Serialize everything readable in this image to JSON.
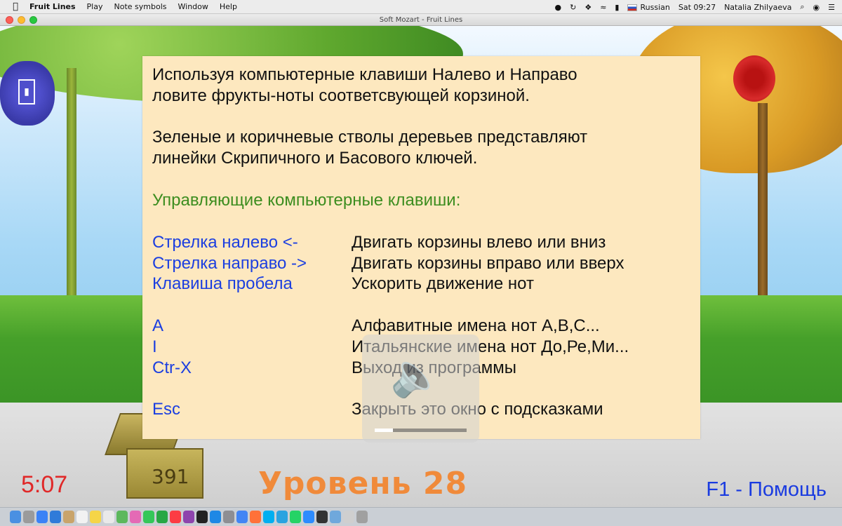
{
  "menubar": {
    "app_name": "Fruit Lines",
    "items": [
      "Play",
      "Note symbols",
      "Window",
      "Help"
    ],
    "input_source": "Russian",
    "clock": "Sat 09:27",
    "user": "Natalia Zhilyaeva"
  },
  "window": {
    "title": "Soft Mozart - Fruit Lines"
  },
  "help_panel": {
    "intro_line1": "Используя компьютерные клавиши Налево и Направо",
    "intro_line2": "ловите фрукты-ноты соответсвующей корзиной.",
    "trees_line1": "Зеленые и коричневые стволы деревьев представляют",
    "trees_line2": "линейки Скрипичного и Басового ключей.",
    "keys_heading": "Управляющие компьютерные клавиши:",
    "keys": [
      {
        "key": "Стрелка налево <-",
        "action": "Двигать корзины влево или вниз"
      },
      {
        "key": "Стрелка направо ->",
        "action": "Двигать корзины вправо или вверх"
      },
      {
        "key": "Клавиша пробела",
        "action": "Ускорить движение нот"
      },
      {
        "key": "A",
        "action": "Алфавитные имена нот A,B,C..."
      },
      {
        "key": "I",
        "action": "Итальянские имена нот До,Ре,Ми..."
      },
      {
        "key": "Ctr-X",
        "action": "Выход из программы"
      },
      {
        "key": "Esc",
        "action": "Закрыть это окно с подсказками"
      }
    ]
  },
  "hud": {
    "timer": "5:07",
    "chest_count": "391",
    "level": "Уровень 28",
    "help": "F1 - Помощь"
  },
  "volume_overlay": {
    "level_fraction": 0.2
  },
  "colors": {
    "panel_bg": "#fde8bf",
    "key_blue": "#1c3fe0",
    "heading_green": "#3c8d1f",
    "timer_red": "#e02828",
    "level_orange": "#f08a3a"
  },
  "dock_icons": [
    "finder-icon",
    "launchpad-icon",
    "safari-icon",
    "mail-icon",
    "contacts-icon",
    "calendar-icon",
    "notes-icon",
    "reminders-icon",
    "maps-icon",
    "photos-icon",
    "messages-icon",
    "facetime-icon",
    "music-icon",
    "podcasts-icon",
    "tv-icon",
    "appstore-icon",
    "settings-icon",
    "chrome-icon",
    "firefox-icon",
    "skype-icon",
    "telegram-icon",
    "whatsapp-icon",
    "zoom-icon",
    "terminal-icon",
    "preview-icon",
    "textedit-icon",
    "trash-icon"
  ]
}
